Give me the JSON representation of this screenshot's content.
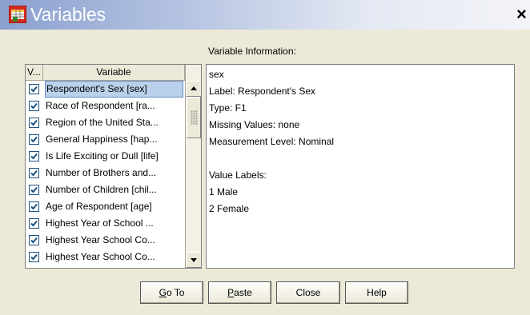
{
  "window": {
    "title": "Variables",
    "close_glyph": "×",
    "icon": "spss-variables-icon"
  },
  "list": {
    "col_v": "V...",
    "col_variable": "Variable",
    "items": [
      {
        "label": "Respondent's Sex [sex]",
        "checked": true,
        "selected": true
      },
      {
        "label": "Race of Respondent [ra...",
        "checked": true,
        "selected": false
      },
      {
        "label": "Region of the United Sta...",
        "checked": true,
        "selected": false
      },
      {
        "label": "General Happiness [hap...",
        "checked": true,
        "selected": false
      },
      {
        "label": "Is Life Exciting or Dull [life]",
        "checked": true,
        "selected": false
      },
      {
        "label": "Number of Brothers and...",
        "checked": true,
        "selected": false
      },
      {
        "label": "Number of Children [chil...",
        "checked": true,
        "selected": false
      },
      {
        "label": "Age of Respondent [age]",
        "checked": true,
        "selected": false
      },
      {
        "label": "Highest Year of School ...",
        "checked": true,
        "selected": false
      },
      {
        "label": "Highest Year School Co...",
        "checked": true,
        "selected": false
      },
      {
        "label": "Highest Year School Co...",
        "checked": true,
        "selected": false
      }
    ]
  },
  "info": {
    "caption": "Variable Information:",
    "lines": [
      "sex",
      "Label:  Respondent's Sex",
      "Type:  F1",
      "Missing Values:  none",
      "Measurement Level:  Nominal",
      "",
      "Value Labels:",
      "1 Male",
      "2 Female"
    ]
  },
  "buttons": {
    "goto": {
      "mnemonic": "G",
      "rest": "o To"
    },
    "paste": {
      "mnemonic": "P",
      "rest": "aste"
    },
    "close": "Close",
    "help": "Help"
  },
  "colors": {
    "selection": "#b9d1ea",
    "check": "#1c5180",
    "dialog_bg": "#ece9d8"
  }
}
